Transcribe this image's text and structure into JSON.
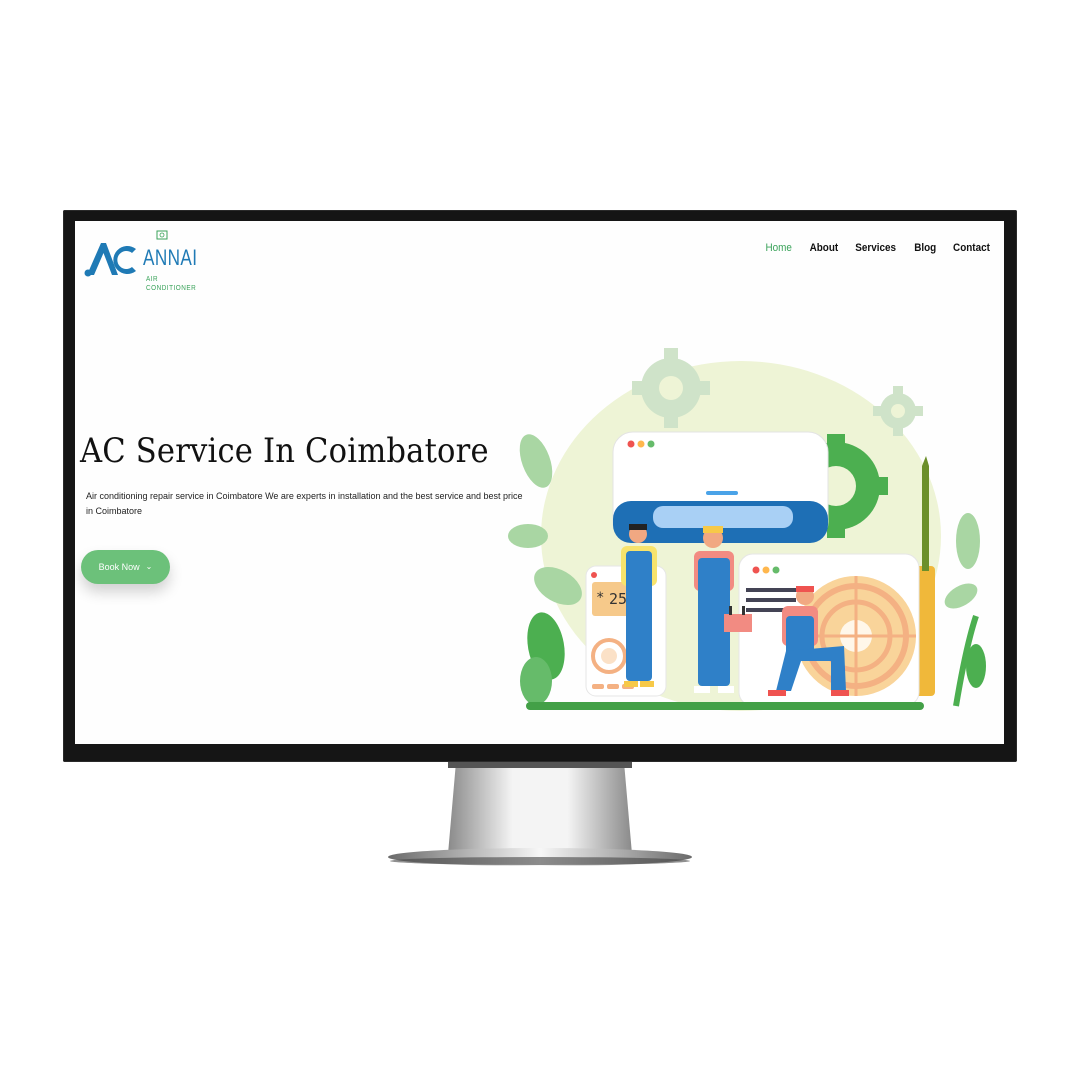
{
  "brand": {
    "logo_text": "ANNAI",
    "logo_subtext": "AIR CONDITIONER",
    "colors": {
      "blue": "#1f7ab5",
      "green": "#3aa35a"
    }
  },
  "nav": {
    "items": [
      {
        "label": "Home",
        "active": true
      },
      {
        "label": "About"
      },
      {
        "label": "Services"
      },
      {
        "label": "Blog"
      },
      {
        "label": "Contact"
      }
    ]
  },
  "hero": {
    "title": "AC Service In Coimbatore",
    "description": "Air conditioning repair service in Coimbatore We are experts in installation and the best service and best price in Coimbatore",
    "button_label": "Book Now",
    "button_color": "#6cc17a"
  },
  "illustration": {
    "ac_display": "25",
    "icon_names": [
      "gear-icon",
      "fan-icon",
      "snowflake-icon",
      "toolbox-icon",
      "screwdriver-icon"
    ]
  }
}
